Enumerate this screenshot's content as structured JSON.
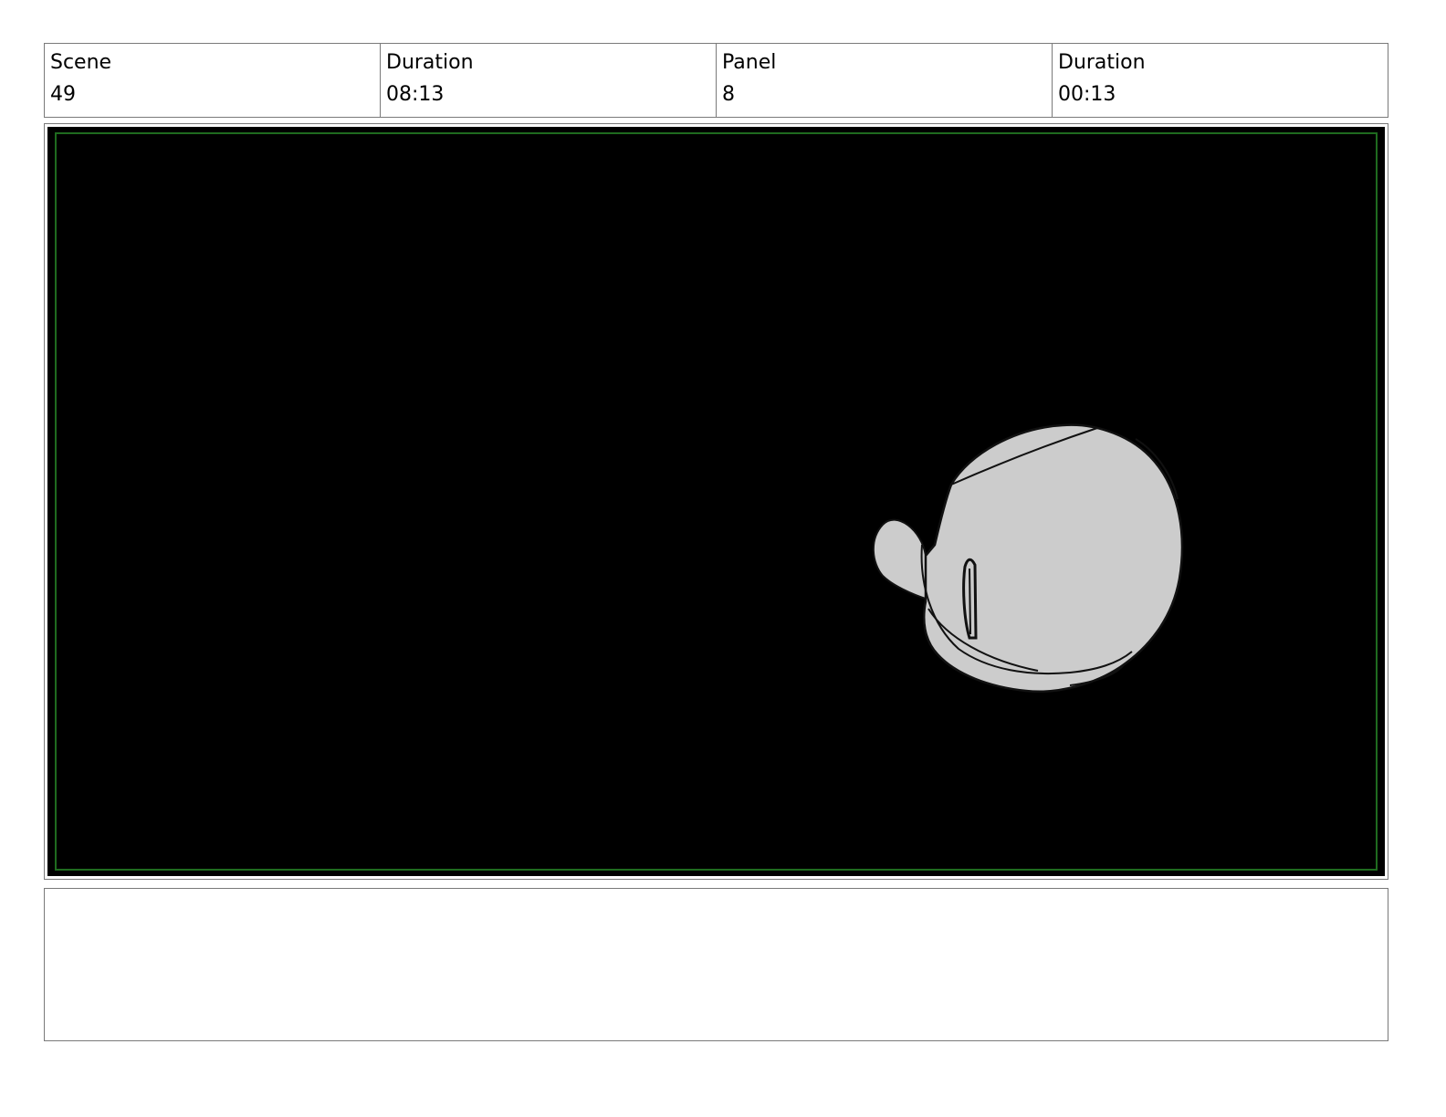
{
  "header": {
    "scene_label": "Scene",
    "scene_value": "49",
    "scene_duration_label": "Duration",
    "scene_duration_value": "08:13",
    "panel_label": "Panel",
    "panel_value": "8",
    "panel_duration_label": "Duration",
    "panel_duration_value": "00:13"
  },
  "panel": {
    "background_color": "#000000",
    "safe_area_color": "#1f6b1f",
    "sketch_fill_color": "#cccccc"
  },
  "notes": {
    "text": ""
  }
}
